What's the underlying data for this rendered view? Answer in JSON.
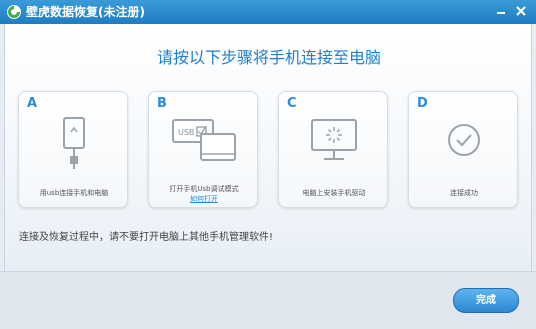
{
  "window": {
    "title": "壁虎数据恢复(未注册)"
  },
  "main": {
    "heading": "请按以下步骤将手机连接至电脑",
    "steps": [
      {
        "letter": "A",
        "label": "用usb连接手机和电脑",
        "icon": "phone-usb-icon"
      },
      {
        "letter": "B",
        "label": "打开手机Usb调试模式",
        "link": "如何打开",
        "icon": "usb-debug-icon"
      },
      {
        "letter": "C",
        "label": "电脑上安装手机驱动",
        "icon": "monitor-loading-icon"
      },
      {
        "letter": "D",
        "label": "连接成功",
        "icon": "check-circle-icon"
      }
    ],
    "notice": "连接及恢复过程中，请不要打开电脑上其他手机管理软件!"
  },
  "footer": {
    "done_label": "完成"
  },
  "colors": {
    "titlebar": "#2a8bd0",
    "accent": "#1e7fcf",
    "icon_gray": "#9aa3ac"
  }
}
